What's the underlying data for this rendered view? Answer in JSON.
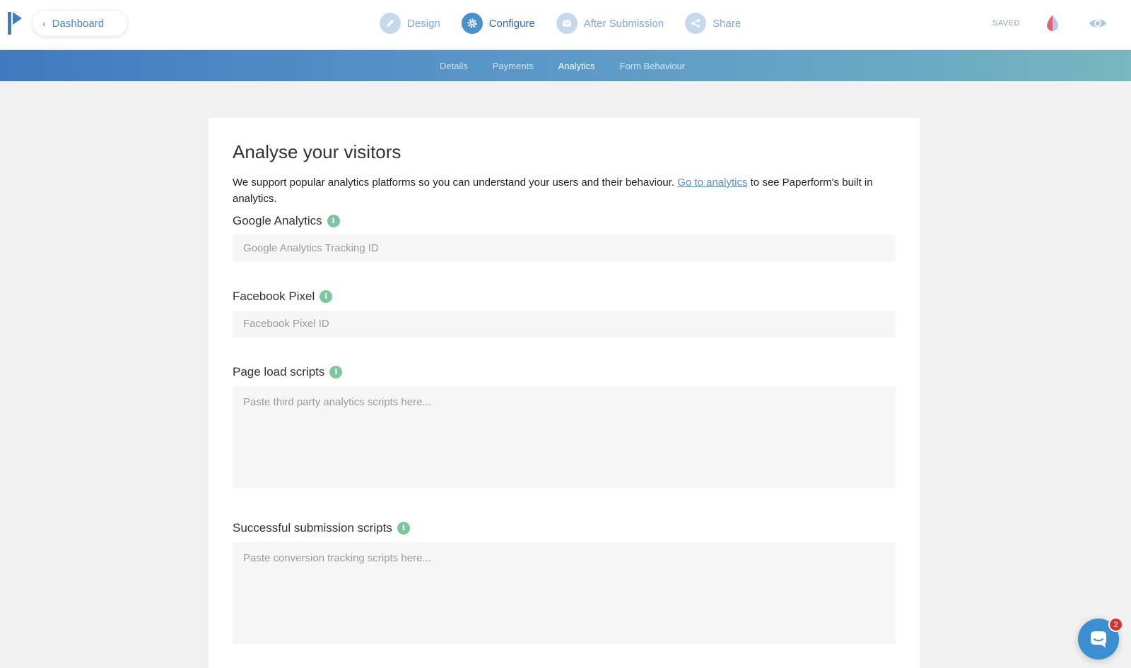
{
  "header": {
    "back_label": "Dashboard",
    "steps": [
      {
        "label": "Design",
        "icon": "pencil-icon"
      },
      {
        "label": "Configure",
        "icon": "gear-icon"
      },
      {
        "label": "After Submission",
        "icon": "envelope-icon"
      },
      {
        "label": "Share",
        "icon": "share-icon"
      }
    ],
    "active_step": "Configure",
    "save_status": "SAVED"
  },
  "subnav": {
    "tabs": [
      "Details",
      "Payments",
      "Analytics",
      "Form Behaviour"
    ],
    "active": "Analytics"
  },
  "main": {
    "title": "Analyse your visitors",
    "description_before": "We support popular analytics platforms so you can understand your users and their behaviour. ",
    "description_link": "Go to analytics",
    "description_after": " to see Paperform's built in analytics.",
    "fields": {
      "google": {
        "label": "Google Analytics",
        "placeholder": "Google Analytics Tracking ID",
        "value": ""
      },
      "facebook": {
        "label": "Facebook Pixel",
        "placeholder": "Facebook Pixel ID",
        "value": ""
      },
      "pageload": {
        "label": "Page load scripts",
        "placeholder": "Paste third party analytics scripts here..."
      },
      "submission": {
        "label": "Successful submission scripts",
        "placeholder": "Paste conversion tracking scripts here..."
      }
    }
  },
  "chat": {
    "badge_count": "2"
  },
  "colors": {
    "accent": "#4a90cc",
    "info_icon": "#7cc59d",
    "badge": "#d0342c"
  }
}
